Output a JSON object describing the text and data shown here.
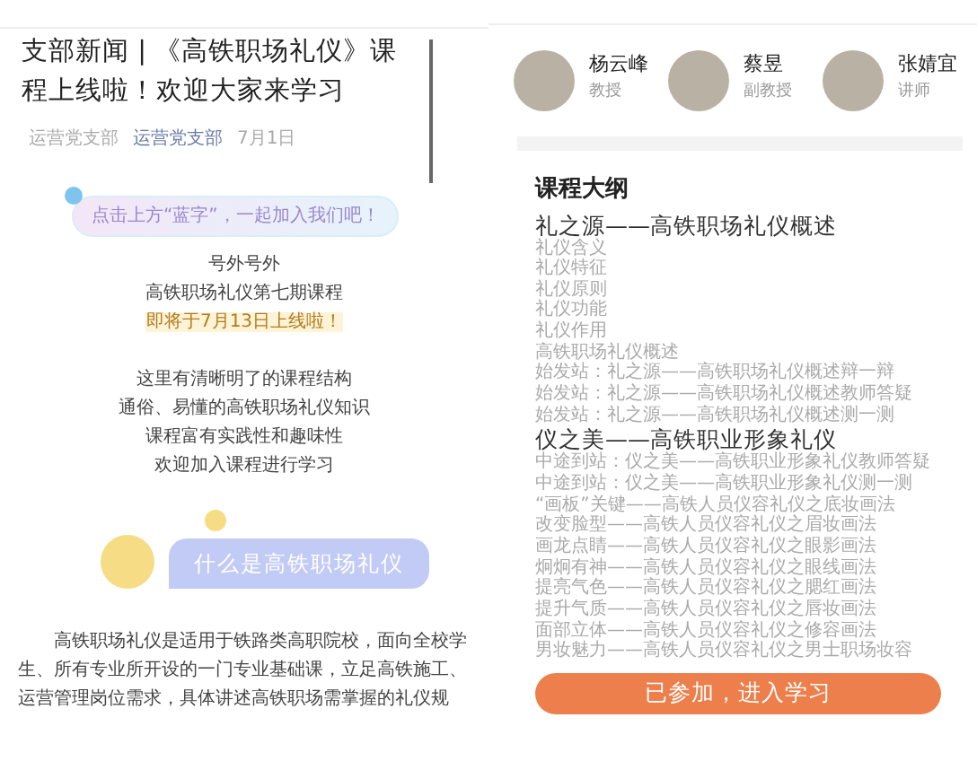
{
  "article": {
    "title": "支部新闻 | 《高铁职场礼仪》课程上线啦！欢迎大家来学习",
    "meta": [
      {
        "text": "运营党支部",
        "kind": "source"
      },
      {
        "text": "运营党支部",
        "kind": "account"
      },
      {
        "text": "7月1日",
        "kind": "date"
      }
    ],
    "banner": "点击上方“蓝字”，一起加入我们吧！",
    "announcement": [
      {
        "text": "号外号外",
        "highlight": false
      },
      {
        "text": "高铁职场礼仪第七期课程",
        "highlight": false
      },
      {
        "text": "即将于7月13日上线啦！",
        "highlight": true
      }
    ],
    "features": [
      "这里有清晰明了的课程结构",
      "通俗、易懂的高铁职场礼仪知识",
      "课程富有实践性和趣味性",
      "欢迎加入课程进行学习"
    ],
    "section_heading": "什么是高铁职场礼仪",
    "body": "高铁职场礼仪是适用于铁路类高职院校，面向全校学生、所有专业所开设的一门专业基础课，立足高铁施工、运营管理岗位需求，具体讲述高铁职场需掌握的礼仪规"
  },
  "course": {
    "teachers": [
      {
        "name": "杨云峰",
        "title": "教授"
      },
      {
        "name": "蔡昱",
        "title": "副教授"
      },
      {
        "name": "张婧宜",
        "title": "讲师"
      }
    ],
    "outline_title": "课程大纲",
    "chapters": [
      {
        "title": "礼之源——高铁职场礼仪概述",
        "lessons": [
          "礼仪含义",
          "礼仪特征",
          "礼仪原则",
          "礼仪功能",
          "礼仪作用",
          "高铁职场礼仪概述",
          "始发站：礼之源——高铁职场礼仪概述辩一辩",
          "始发站：礼之源——高铁职场礼仪概述教师答疑",
          "始发站：礼之源——高铁职场礼仪概述测一测"
        ]
      },
      {
        "title": "仪之美——高铁职业形象礼仪",
        "lessons": [
          "中途到站：仪之美——高铁职业形象礼仪教师答疑",
          "中途到站：仪之美——高铁职业形象礼仪测一测",
          "“画板”关键——高铁人员仪容礼仪之底妆画法",
          "改变脸型——高铁人员仪容礼仪之眉妆画法",
          "画龙点睛——高铁人员仪容礼仪之眼影画法",
          "炯炯有神——高铁人员仪容礼仪之眼线画法",
          "提亮气色——高铁人员仪容礼仪之腮红画法",
          "提升气质——高铁人员仪容礼仪之唇妆画法",
          "面部立体——高铁人员仪容礼仪之修容画法",
          "男妆魅力——高铁人员仪容礼仪之男士职场妆容"
        ]
      }
    ],
    "button": "已参加，进入学习"
  }
}
